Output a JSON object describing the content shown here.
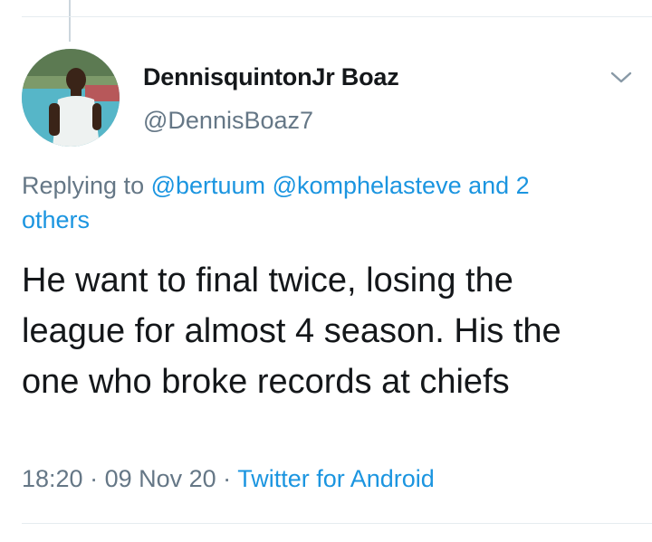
{
  "tweet": {
    "display_name": "DennisquintonJr Boaz",
    "handle": "@DennisBoaz7",
    "reply_prefix": "Replying to ",
    "reply_mention_1": "@bertuum",
    "reply_mention_2": "@komphelasteve",
    "reply_mention_3": "and 2 others",
    "text": "He want to final twice, losing the league for almost 4 season. His the one who broke records at chiefs",
    "time": "18:20",
    "date": "09 Nov 20",
    "source": "Twitter for Android",
    "separator": " · "
  },
  "icons": {
    "menu": "chevron-down-icon",
    "avatar": "profile-photo"
  },
  "colors": {
    "link": "#1b95e0",
    "secondary_text": "#657786",
    "primary_text": "#14171a",
    "divider": "#e6ecf0"
  }
}
